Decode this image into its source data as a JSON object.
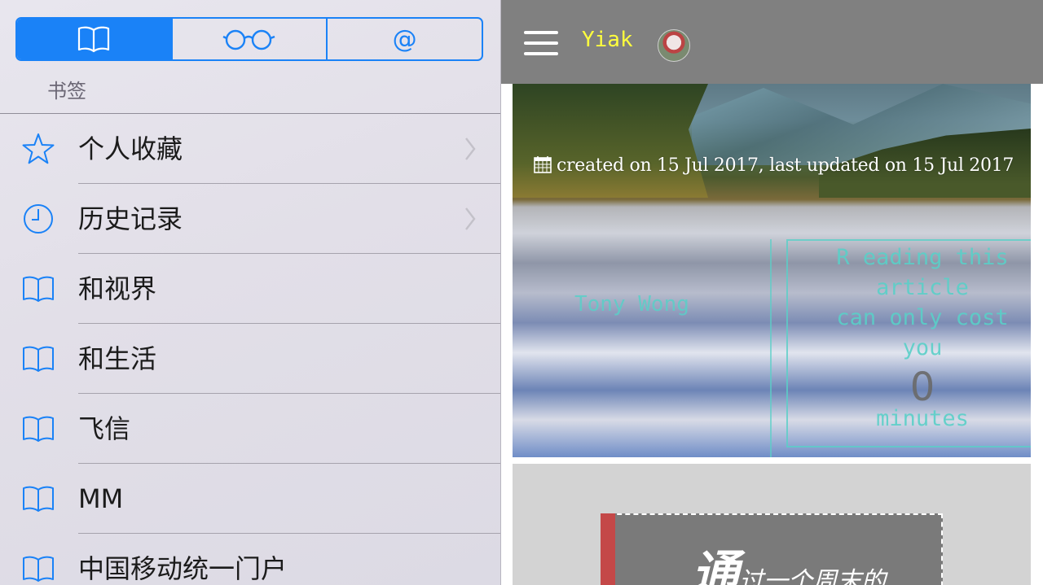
{
  "sidebar": {
    "tabs": [
      {
        "name": "bookmarks-tab",
        "icon": "book-icon",
        "active": true
      },
      {
        "name": "reading-list-tab",
        "icon": "glasses-icon",
        "active": false
      },
      {
        "name": "shared-links-tab",
        "icon": "at-icon",
        "label": "@",
        "active": false
      }
    ],
    "section_title": "书签",
    "items": [
      {
        "icon": "star-icon",
        "label": "个人收藏",
        "chevron": true
      },
      {
        "icon": "clock-icon",
        "label": "历史记录",
        "chevron": true
      },
      {
        "icon": "book-icon",
        "label": "和视界",
        "chevron": false
      },
      {
        "icon": "book-icon",
        "label": "和生活",
        "chevron": false
      },
      {
        "icon": "book-icon",
        "label": "飞信",
        "chevron": false
      },
      {
        "icon": "book-icon",
        "label": "MM",
        "chevron": false
      },
      {
        "icon": "book-icon",
        "label": "中国移动统一门户",
        "chevron": false
      }
    ]
  },
  "page": {
    "brand": "Yiak",
    "meta": "created on 15 Jul 2017, last updated on 15 Jul 2017",
    "author": "Tony Wong",
    "reading": {
      "line1": "R eading this",
      "line2": "article",
      "line3": "can only cost",
      "line4": "you",
      "minutes": "0",
      "unit": "minutes"
    },
    "quote": {
      "big_char": "通",
      "rest": "过一个周末的"
    }
  },
  "colors": {
    "accent": "#1a82f7",
    "brand": "#ffff3d",
    "teal": "#5ad0c8",
    "quote_bar": "#c44848"
  }
}
